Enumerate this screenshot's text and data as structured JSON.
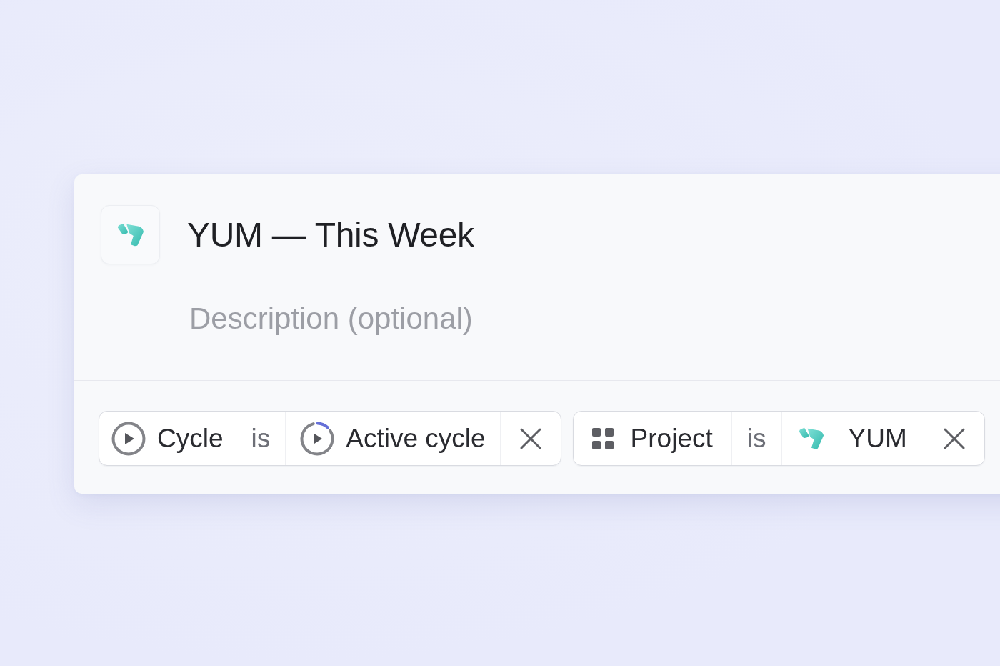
{
  "view": {
    "title": "YUM — This Week",
    "description": {
      "placeholder": "Description (optional)"
    },
    "filters": [
      {
        "kind": "cycle",
        "field": "Cycle",
        "operator": "is",
        "value": {
          "label": "Active cycle",
          "level": 0.12
        }
      },
      {
        "kind": "project",
        "field": "Project",
        "operator": "is",
        "value": {
          "label": "YUM"
        }
      }
    ]
  }
}
